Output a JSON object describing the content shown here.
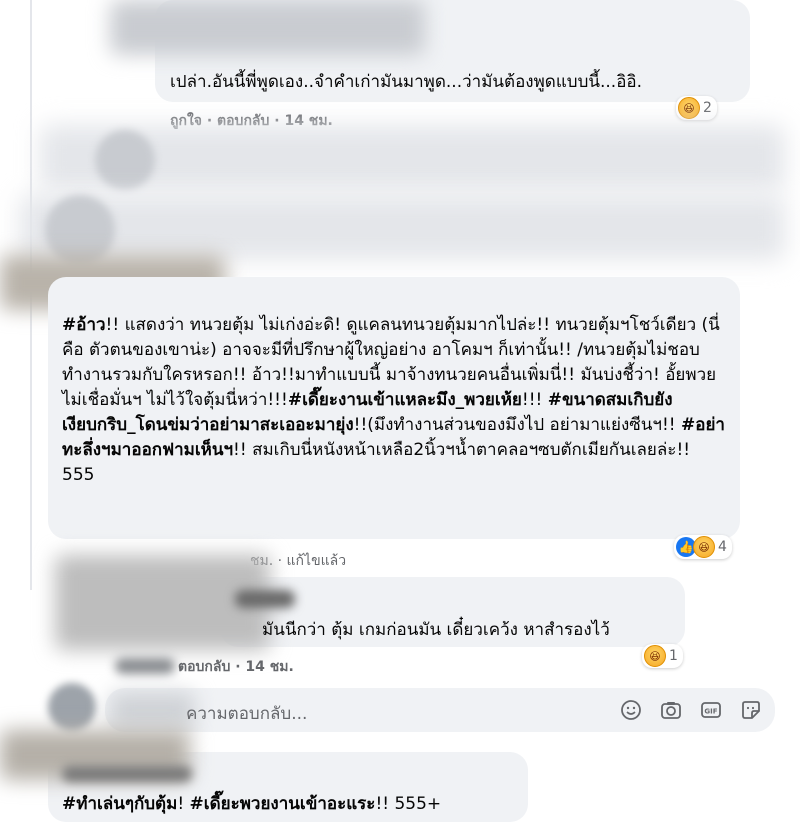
{
  "comment1": {
    "text": "เปล่า.อันนี้พี่พูดเอง..จำคำเก่ามันมาพูด...ว่ามันต้องพูดแบบนี้...อิอิ.",
    "actions": "ถูกใจ · ตอบกลับ · 14 ชม.",
    "reaction_count": "2"
  },
  "comment_main": {
    "segments": [
      {
        "t": "#อ้าว",
        "b": true
      },
      {
        "t": "!! แสดงว่า ทนวยตุ้ม ไม่เก่งอ่ะดิ! ดูแคลนทนวยตุ้มมากไปล่ะ!! ทนวยตุ้มฯโชว์เดียว (นี่คือ ตัวตนของเขาน่ะ) อาจจะมีที่ปรึกษาผู้ใหญ่อย่าง อาโคมฯ ก็เท่านั้น!! /ทนวยตุ้มไม่ชอบ ทำงานรวมกับใครหรอก!! อ้าว!!มาทำแบบนี้ มาจ้างทนวยคนอื่นเพิ่มนี่!! มันบ่งชี้ว่า! อั้ยพวยไม่เชื่อมั่นฯ ไม่ไว้ใจตุ้มนี่หว่า!!!",
        "b": false
      },
      {
        "t": "#เดี๊ยะงานเข้าแหละมึง_พวยเห้ย",
        "b": true
      },
      {
        "t": "!!! ",
        "b": false
      },
      {
        "t": "#ขนาดสมเกิบยังเงียบกริบ_โดนข่มว่าอย่ามาสะเออะมายุ่ง",
        "b": true
      },
      {
        "t": "!!(มึงทำงานส่วนของมึงไป อย่ามาแย่งซีนฯ!! ",
        "b": false
      },
      {
        "t": "#อย่าทะลึ่งฯมาออกฟามเห็นฯ",
        "b": true
      },
      {
        "t": "!! สมเกิบนี่หนังหน้าเหลือ2นิ้วฯน้ำตาคลอฯซบตักเมียกันเลยล่ะ!! 555",
        "b": false
      }
    ],
    "meta": "ชม. · แก้ไขแล้ว",
    "reaction_count": "4"
  },
  "comment3": {
    "text": "มันนีกว่า ตุ้ม เกมก่อนมัน เดี๋ยวเคว้ง หาสำรองไว้",
    "actions": "ตอบกลับ · 14 ชม.",
    "reaction_count": "1"
  },
  "reply_box": {
    "placeholder": "ความตอบกลับ..."
  },
  "comment4": {
    "segments": [
      {
        "t": "#ทำเล่นๆกับตุ้ม",
        "b": true
      },
      {
        "t": "! ",
        "b": false
      },
      {
        "t": "#เดี๊ยะพวยงานเข้าอะแระ",
        "b": true
      },
      {
        "t": "!! 555+",
        "b": false
      }
    ]
  },
  "colors": {
    "bubble": "#f0f2f5",
    "meta": "#65676b",
    "like_blue": "#1877f2",
    "haha_yellow": "#f6a623"
  }
}
